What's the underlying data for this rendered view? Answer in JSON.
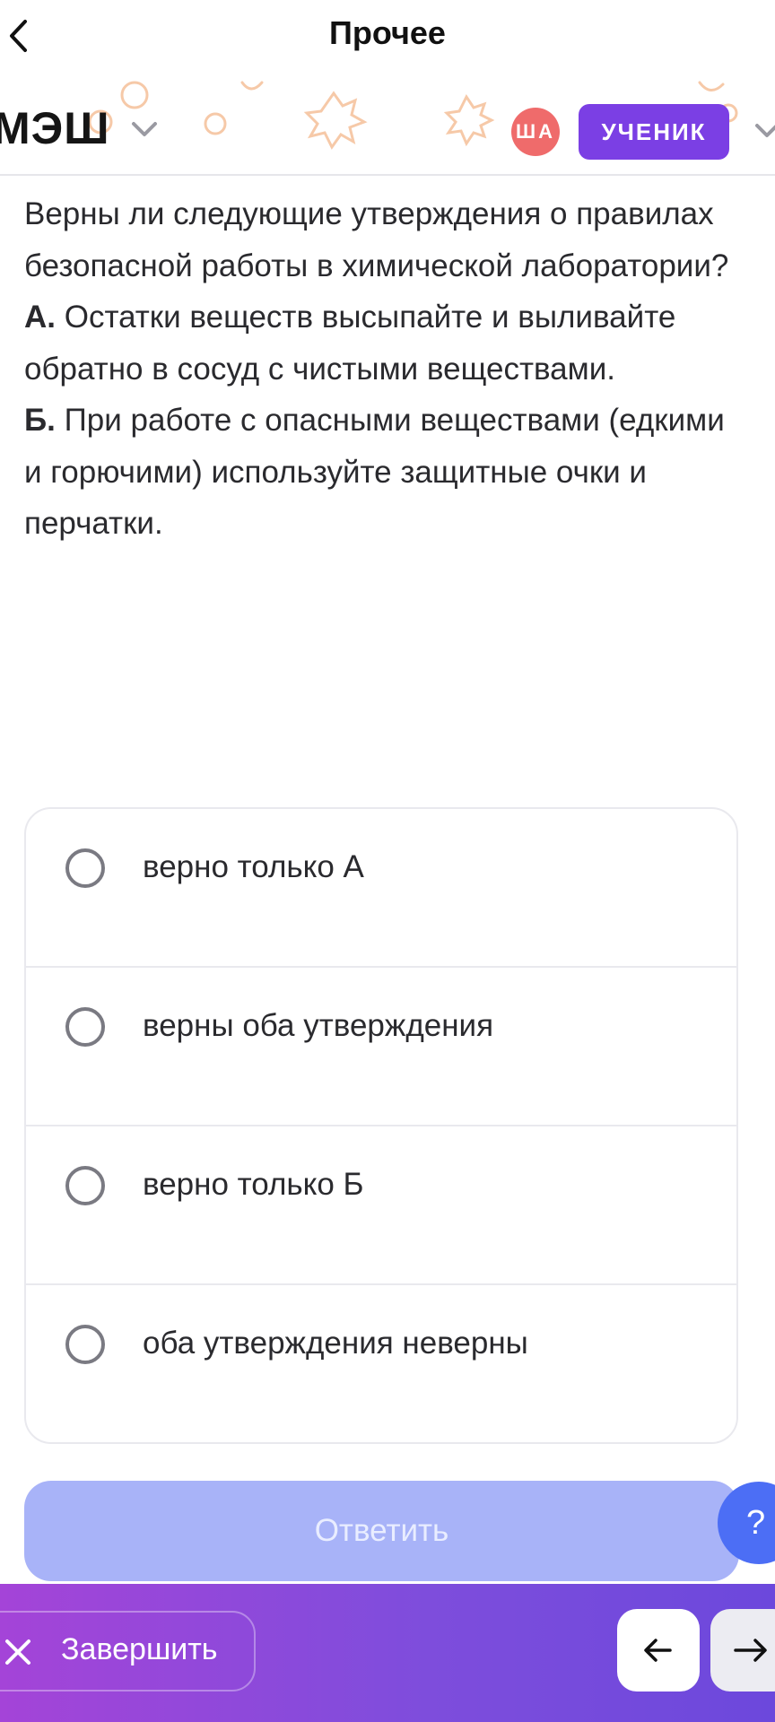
{
  "nav": {
    "title": "Прочее",
    "back_icon": "chevron-left-icon"
  },
  "header": {
    "logo": "МЭШ",
    "avatar_initials": "ША",
    "avatar_color": "#ef6b6b",
    "role": "УЧЕНИК",
    "role_color": "#7b3fe4",
    "decoration_color": "#f6c9a8"
  },
  "question": {
    "intro": "Верны ли следующие утверждения о правилах безопасной работы в химической лаборатории?",
    "statements": [
      {
        "letter": "А.",
        "text": " Остатки веществ высыпайте и выливайте обратно в сосуд с чистыми веществами."
      },
      {
        "letter": "Б.",
        "text": " При работе с опасными веществами (едкими и горючими) используйте защитные очки и перчатки."
      }
    ]
  },
  "options": [
    {
      "label": "верно только А",
      "selected": false
    },
    {
      "label": "верны оба утверждения",
      "selected": false
    },
    {
      "label": "верно только Б",
      "selected": false
    },
    {
      "label": "оба утверждения неверны",
      "selected": false
    }
  ],
  "submit": {
    "label": "Ответить",
    "disabled": true,
    "color": "#a8b3f8"
  },
  "help": {
    "label": "?",
    "color": "#4c6ef5"
  },
  "bottom_bar": {
    "finish_label": "Завершить",
    "finish_icon": "close-icon",
    "prev_icon": "arrow-left-icon",
    "next_icon": "arrow-right-icon",
    "gradient": [
      "#a444d8",
      "#6c48dc"
    ]
  }
}
